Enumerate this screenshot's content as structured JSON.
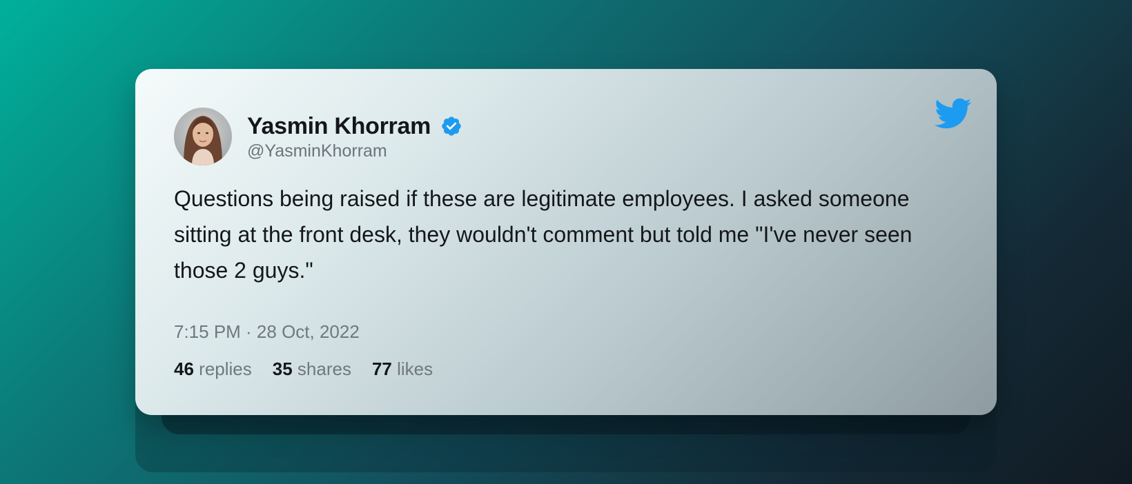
{
  "tweet": {
    "author": {
      "display_name": "Yasmin Khorram",
      "handle": "@YasminKhorram",
      "verified": true,
      "avatar": "avatar-photo"
    },
    "text": "Questions being raised if these are legitimate employees. I asked someone sitting at the front desk, they wouldn't comment but told me \"I've never seen those 2 guys.\"",
    "timestamp": "7:15 PM · 28 Oct, 2022",
    "stats": [
      {
        "count": "46",
        "label": "replies"
      },
      {
        "count": "35",
        "label": "shares"
      },
      {
        "count": "77",
        "label": "likes"
      }
    ]
  },
  "icons": {
    "brand": "twitter-bird-icon",
    "verified": "verified-badge-icon"
  },
  "colors": {
    "twitter_blue": "#1d9bf0",
    "background_start": "#00b09b",
    "background_end": "#111a22"
  }
}
